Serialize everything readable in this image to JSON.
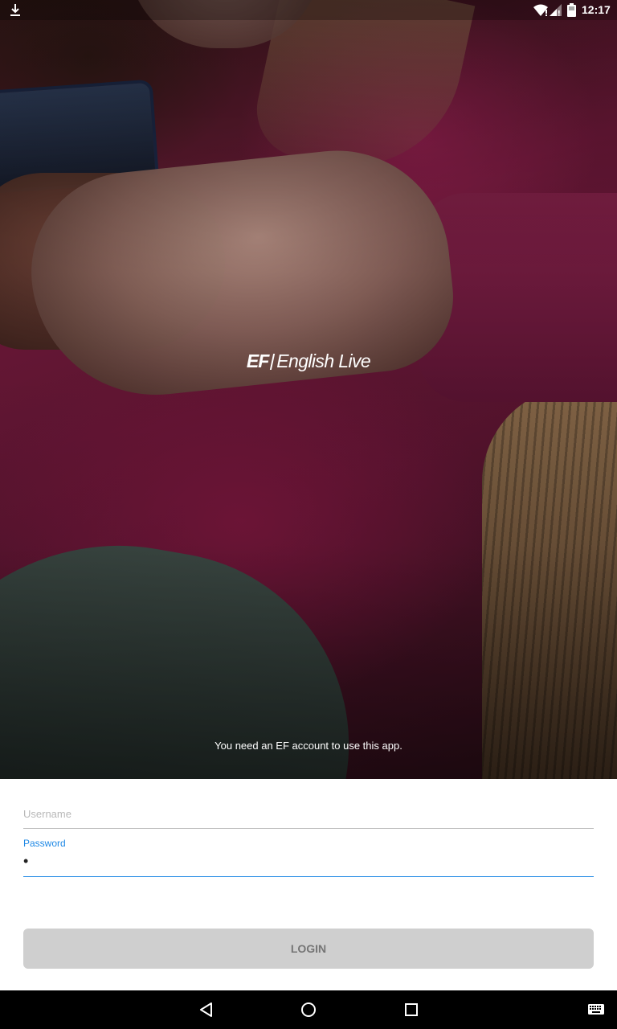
{
  "status_bar": {
    "time": "12:17",
    "left_icon": "download-icon",
    "right_icons": [
      "wifi-icon",
      "signal-icon",
      "battery-icon"
    ]
  },
  "hero": {
    "logo": {
      "mark": "EF",
      "text": "English Live"
    },
    "account_note": "You need an  EF account  to use this app."
  },
  "form": {
    "username": {
      "placeholder": "Username",
      "value": ""
    },
    "password": {
      "label": "Password",
      "value": "•"
    },
    "login_label": "LOGIN"
  },
  "nav_bar": {
    "buttons": [
      "back-icon",
      "home-icon",
      "recents-icon",
      "keyboard-icon"
    ]
  },
  "colors": {
    "accent": "#1e88e5",
    "button_disabled_bg": "#cfcfcf",
    "button_disabled_text": "#757575"
  }
}
